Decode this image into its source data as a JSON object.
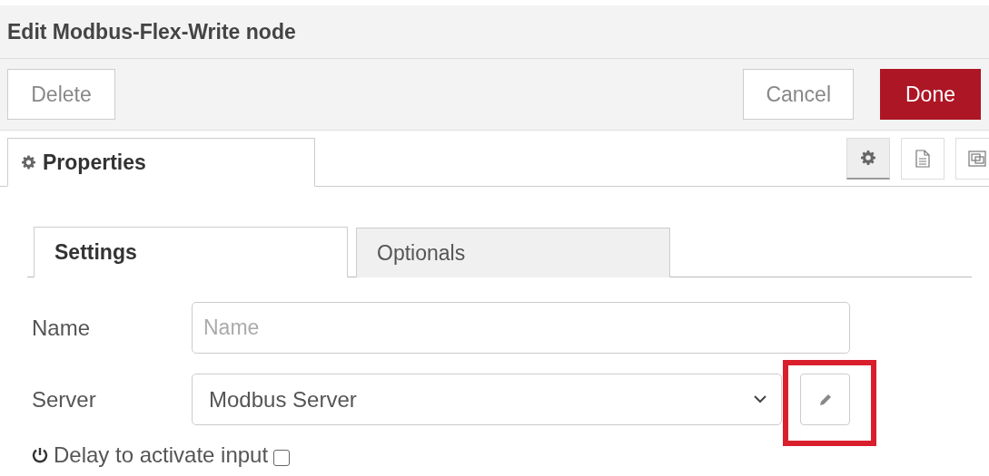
{
  "title": "Edit Modbus-Flex-Write node",
  "actions": [
    {
      "label": "Delete",
      "kind": "delete"
    },
    {
      "label": "Cancel",
      "kind": "cancel"
    },
    {
      "label": "Done",
      "kind": "done"
    }
  ],
  "tray_tabs": [
    {
      "label": "Properties",
      "selected": true
    }
  ],
  "side_buttons": [
    {
      "kind": "settings",
      "selected": true
    },
    {
      "kind": "description",
      "selected": false
    },
    {
      "kind": "appearance",
      "selected": false
    }
  ],
  "form_tabs": [
    {
      "label": "Settings",
      "selected": true
    },
    {
      "label": "Optionals",
      "selected": false
    }
  ],
  "fields": [
    {
      "kind": "text",
      "label": "Name",
      "placeholder": "Name"
    },
    {
      "kind": "select",
      "label": "Server",
      "value": "Modbus Server",
      "edit_highlighted": true
    }
  ],
  "delay": {
    "label": "Delay to activate input",
    "checked": false
  }
}
